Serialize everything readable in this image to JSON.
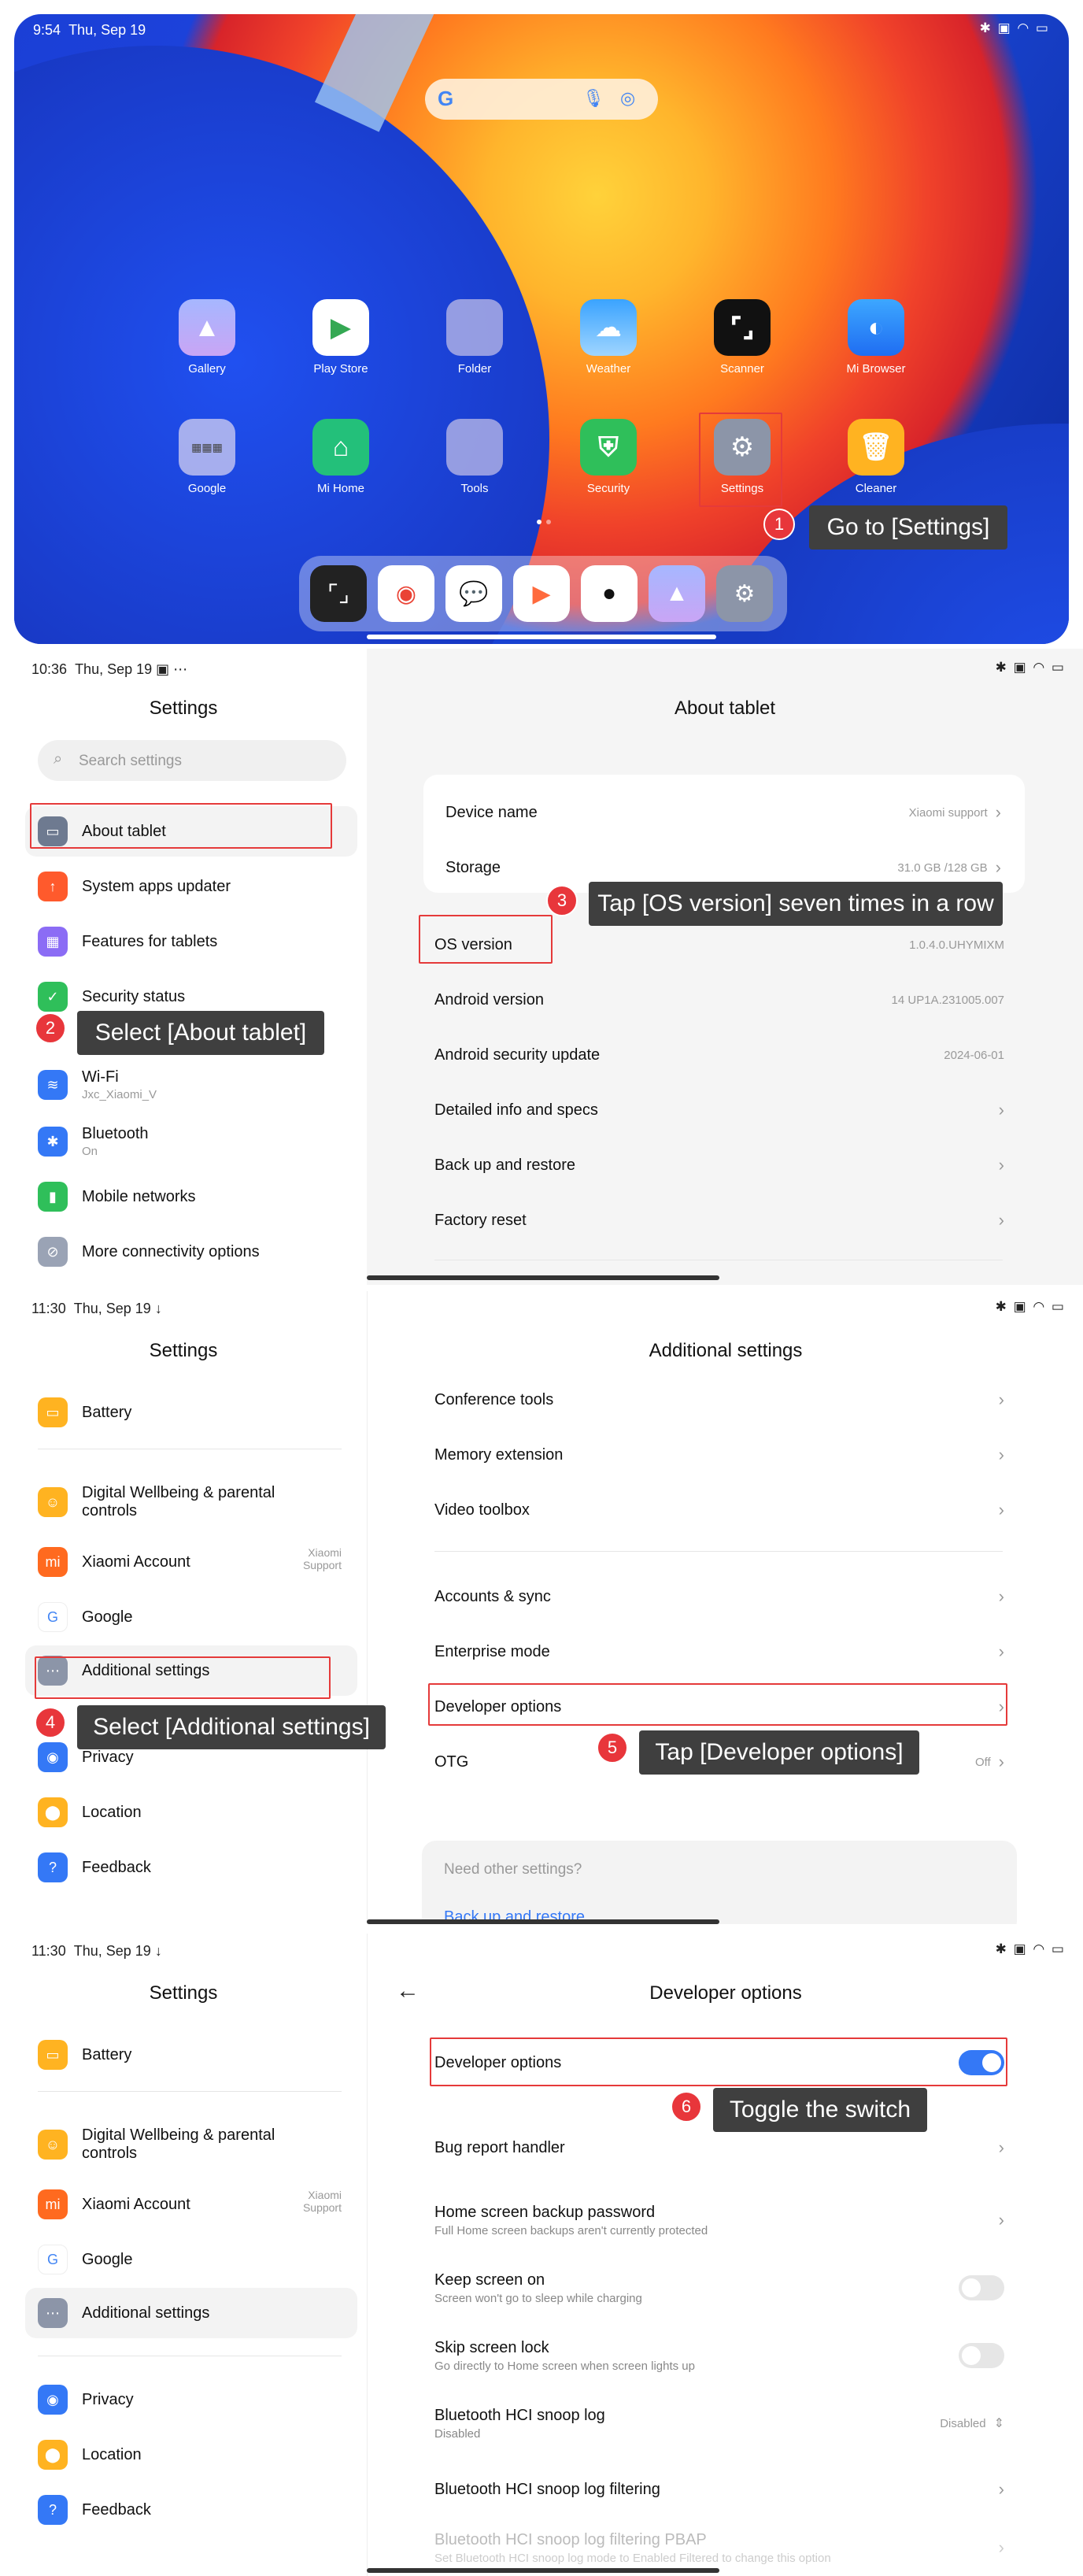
{
  "panel1": {
    "time": "9:54",
    "date": "Thu, Sep 19",
    "status_icons": "✱ ▣ ◠ ▭",
    "apps_row1": [
      "Gallery",
      "Play Store",
      "Folder",
      "Weather",
      "Scanner",
      "Mi Browser"
    ],
    "apps_row2": [
      "Google",
      "Mi Home",
      "Tools",
      "Security",
      "Settings",
      "Cleaner"
    ],
    "step1": {
      "num": "1",
      "text": "Go to [Settings]"
    }
  },
  "panel2": {
    "time": "10:36",
    "date": "Thu, Sep 19",
    "left_title": "Settings",
    "search_placeholder": "Search settings",
    "left_items": [
      {
        "label": "About tablet"
      },
      {
        "label": "System apps updater"
      },
      {
        "label": "Features for tablets"
      },
      {
        "label": "Security status"
      },
      {
        "label": "Wi-Fi",
        "sub": "Jxc_Xiaomi_V"
      },
      {
        "label": "Bluetooth",
        "sub": "On"
      },
      {
        "label": "Mobile networks"
      },
      {
        "label": "More connectivity options"
      }
    ],
    "right_title": "About tablet",
    "rows": [
      {
        "label": "Device name",
        "value": "Xiaomi support"
      },
      {
        "label": "Storage",
        "value": "31.0 GB /128 GB"
      },
      {
        "label": "OS version",
        "value": "1.0.4.0.UHYMIXM"
      },
      {
        "label": "Android version",
        "value": "14 UP1A.231005.007"
      },
      {
        "label": "Android security update",
        "value": "2024-06-01"
      },
      {
        "label": "Detailed info and specs",
        "value": ""
      },
      {
        "label": "Back up and restore",
        "value": ""
      },
      {
        "label": "Factory reset",
        "value": ""
      }
    ],
    "step2": {
      "num": "2",
      "text": "Select [About tablet]"
    },
    "step3": {
      "num": "3",
      "text": "Tap [OS version] seven times in a row"
    }
  },
  "panel3": {
    "time": "11:30",
    "date": "Thu, Sep 19",
    "left_title": "Settings",
    "left_items": [
      {
        "label": "Battery"
      },
      {
        "label": "Digital Wellbeing & parental controls"
      },
      {
        "label": "Xiaomi Account",
        "side": "Xiaomi Support"
      },
      {
        "label": "Google"
      },
      {
        "label": "Additional settings"
      },
      {
        "label": "Privacy"
      },
      {
        "label": "Location"
      },
      {
        "label": "Feedback"
      }
    ],
    "right_title": "Additional settings",
    "rows": [
      {
        "label": "Conference tools",
        "value": ""
      },
      {
        "label": "Memory extension",
        "value": ""
      },
      {
        "label": "Video toolbox",
        "value": ""
      },
      {
        "label": "Accounts & sync",
        "value": ""
      },
      {
        "label": "Enterprise mode",
        "value": ""
      },
      {
        "label": "Developer options",
        "value": ""
      },
      {
        "label": "OTG",
        "value": "Off"
      }
    ],
    "other_title": "Need other settings?",
    "other_link": "Back up and restore",
    "step4": {
      "num": "4",
      "text": "Select [Additional settings]"
    },
    "step5": {
      "num": "5",
      "text": "Tap [Developer options]"
    }
  },
  "panel4": {
    "time": "11:30",
    "date": "Thu, Sep 19",
    "left_title": "Settings",
    "right_title": "Developer options",
    "rows": [
      {
        "label": "Developer options",
        "sub": "",
        "value": ""
      },
      {
        "label": "Bug report handler",
        "sub": "",
        "value": ""
      },
      {
        "label": "Home screen backup password",
        "sub": "Full Home screen backups aren't currently protected",
        "value": ""
      },
      {
        "label": "Keep screen on",
        "sub": "Screen won't go to sleep while charging",
        "value": ""
      },
      {
        "label": "Skip screen lock",
        "sub": "Go directly to Home screen when screen lights up",
        "value": ""
      },
      {
        "label": "Bluetooth HCI snoop log",
        "sub": "Disabled",
        "value": "Disabled"
      },
      {
        "label": "Bluetooth HCI snoop log filtering",
        "sub": "",
        "value": ""
      },
      {
        "label": "Bluetooth HCI snoop log filtering PBAP",
        "sub": "Set Bluetooth HCI snoop log mode to Enabled Filtered to change this option",
        "value": ""
      }
    ],
    "step6": {
      "num": "6",
      "text": "Toggle the switch"
    }
  }
}
